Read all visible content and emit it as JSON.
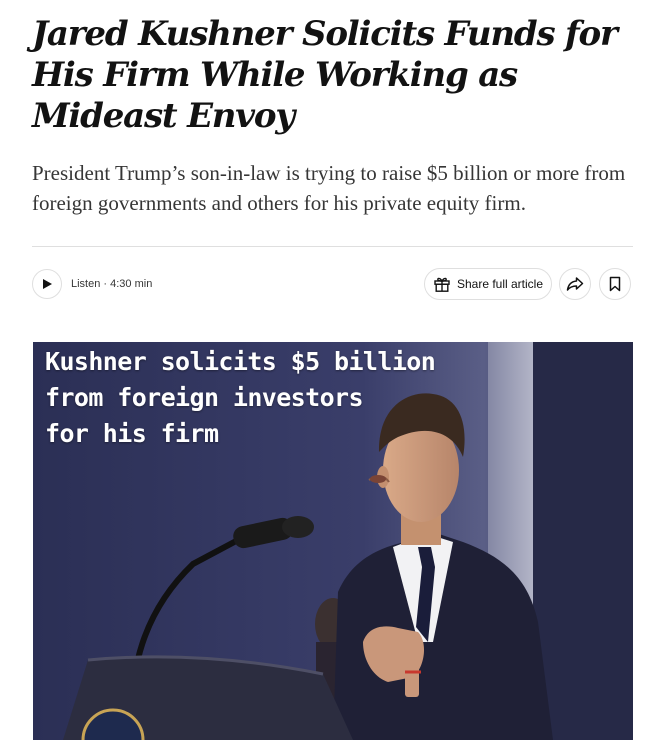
{
  "article": {
    "headline": "Jared Kushner Solicits Funds for His Firm While Working as Mideast Envoy",
    "summary": "President Trump’s son-in-law is trying to raise $5 billion or more from foreign governments and others for his private equity firm."
  },
  "toolbar": {
    "listen_label": "Listen · 4:30 min",
    "share_full_article_label": "Share full article",
    "play_icon": "play-icon",
    "gift_icon": "gift-icon",
    "share_icon": "share-arrow-icon",
    "bookmark_icon": "bookmark-icon"
  },
  "photo": {
    "overlay_text": "Kushner solicits $5 billion\nfrom foreign investors\nfor his firm"
  },
  "colors": {
    "text": "#121212",
    "summary_text": "#363636",
    "divider": "#dfdfdf",
    "photo_background": "#2e3257"
  }
}
